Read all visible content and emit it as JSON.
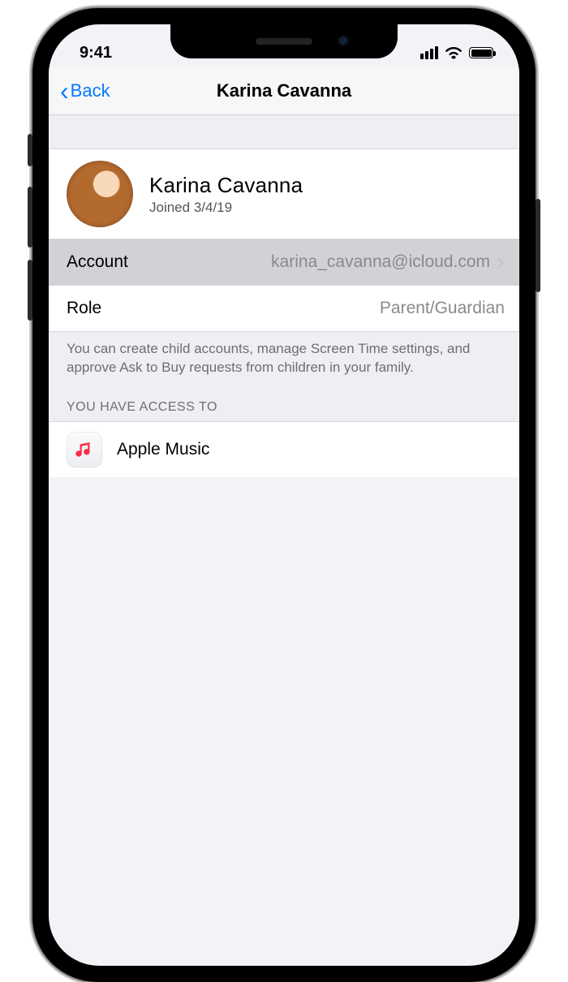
{
  "status": {
    "time": "9:41"
  },
  "nav": {
    "back": "Back",
    "title": "Karina Cavanna"
  },
  "profile": {
    "name": "Karina Cavanna",
    "joined_prefix": "Joined ",
    "joined_date": "3/4/19"
  },
  "rows": {
    "account": {
      "label": "Account",
      "value": "karina_cavanna@icloud.com"
    },
    "role": {
      "label": "Role",
      "value": "Parent/Guardian"
    }
  },
  "role_footer": "You can create child accounts, manage Screen Time settings, and approve Ask to Buy requests from children in your family.",
  "access": {
    "header": "You Have Access To",
    "items": [
      {
        "label": "Apple Music",
        "icon": "music-app-icon"
      }
    ]
  },
  "colors": {
    "ios_blue": "#007aff",
    "music_red": "#fa2d48"
  }
}
